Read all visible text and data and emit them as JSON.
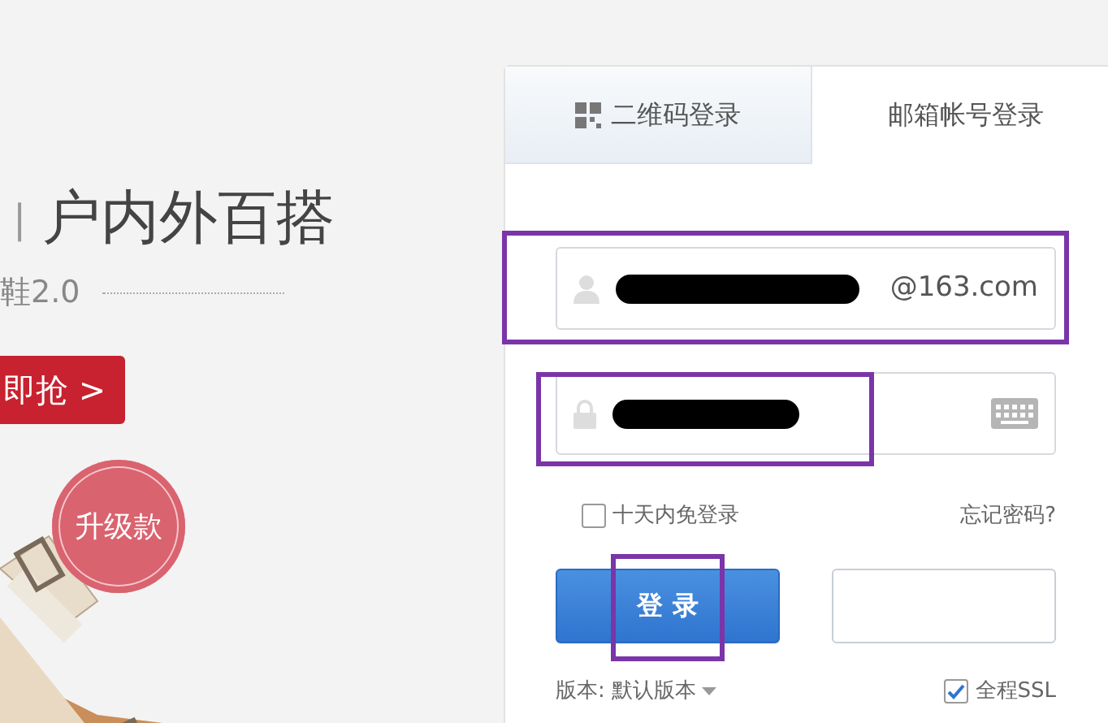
{
  "banner": {
    "separator": "|",
    "title": "户内外百搭",
    "subtitle": "鞋2.0",
    "cta": "即抢 >",
    "badge": "升级款"
  },
  "login": {
    "tabs": [
      {
        "label": "二维码登录",
        "selected": false,
        "kind": "qr"
      },
      {
        "label": "邮箱帐号登录",
        "selected": true,
        "kind": "plain"
      }
    ],
    "username": {
      "domain": "@163.com"
    },
    "remember": {
      "label": "十天内免登录",
      "checked": false
    },
    "forgot": "忘记密码?",
    "login_button": "登 录",
    "version": "版本: 默认版本",
    "ssl": {
      "label": "全程SSL",
      "checked": true
    }
  }
}
